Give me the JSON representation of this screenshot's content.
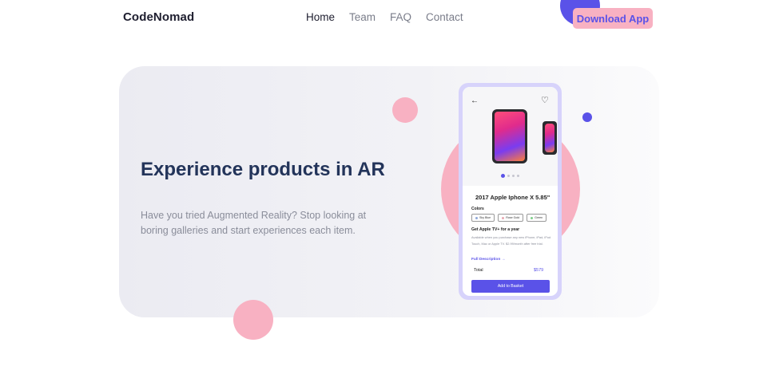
{
  "header": {
    "logo": "CodeNomad",
    "nav": [
      "Home",
      "Team",
      "FAQ",
      "Contact"
    ],
    "active_nav": "Home",
    "cta_label": "Download App"
  },
  "hero": {
    "title": "Experience products in AR",
    "subtitle": "Have you tried Augmented Reality? Stop looking at boring galleries and start experiences each item."
  },
  "phone": {
    "product_name": "2017 Apple Iphone X 5.85\"",
    "colors_label": "Colors",
    "colors": [
      "Sky Blue",
      "Rose Gold",
      "Green"
    ],
    "offer_title": "Get Apple TV+ for a year",
    "offer_text": "Available when you purchase any new iPhone, iPad, iPod Touch, Mac or Apple TV. $2.99/month after free trial.",
    "full_description_link": "Full Description →",
    "total_label": "Total",
    "total_price": "$579",
    "add_to_basket": "Add to Basket"
  },
  "colors": {
    "accent": "#5a52e8",
    "pink": "#f8b1c2",
    "title": "#23345a",
    "chip_sky_blue": "#8fa8d8",
    "chip_rose_gold": "#e8a8b0",
    "chip_green": "#7fcf8a"
  }
}
